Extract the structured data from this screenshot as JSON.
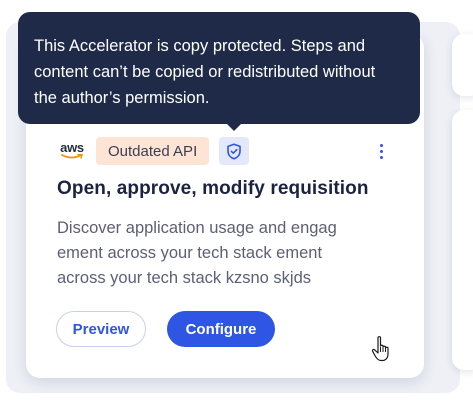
{
  "tooltip": {
    "lines": [
      "This Accelerator is copy protected. Steps and",
      "content can’t be copied or redistributed without",
      "the author’s permission."
    ]
  },
  "card": {
    "logo_text": "aws",
    "logo_icon": "aws-logo",
    "tag_label": "Outdated API",
    "shield_icon": "shield-check-icon",
    "menu_icon": "kebab-menu-icon",
    "title": "Open, approve, modify requisition",
    "description_lines": [
      "Discover application usage and engag",
      "ement across your tech stack ement",
      "across your tech stack kzsno skjds"
    ],
    "preview_label": "Preview",
    "configure_label": "Configure"
  },
  "cursor_icon": "hand-pointer-icon",
  "colors": {
    "accent": "#2f55e4",
    "tooltip_bg": "#1e2a47",
    "tag_bg": "#fde4d4",
    "shield_bg": "#e3e8fb",
    "title": "#1c2340",
    "body_text": "#5c6075"
  }
}
